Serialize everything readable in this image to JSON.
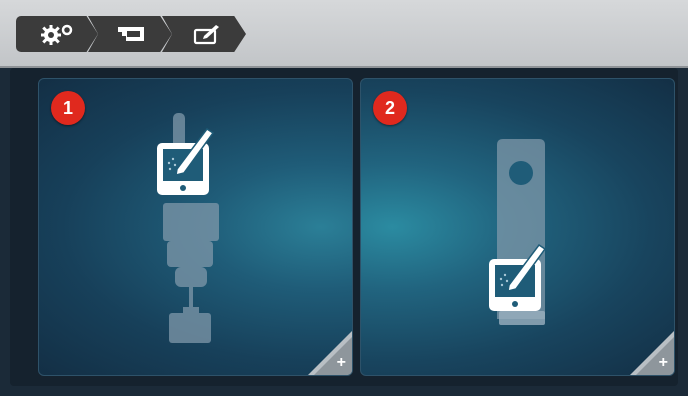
{
  "breadcrumb": [
    {
      "icon": "settings-icon"
    },
    {
      "icon": "presser-foot-icon"
    },
    {
      "icon": "edit-tablet-icon"
    }
  ],
  "tiles": [
    {
      "number": "1",
      "icon": "presser-foot-calibration-icon",
      "action_icon": "add-icon"
    },
    {
      "number": "2",
      "icon": "foot-sole-calibration-icon",
      "action_icon": "add-icon"
    }
  ],
  "colors": {
    "badge": "#e0291e",
    "topbar": "#c9cbcd",
    "crumb": "#3b3b3b",
    "tile_accent": "#2b7f97"
  }
}
